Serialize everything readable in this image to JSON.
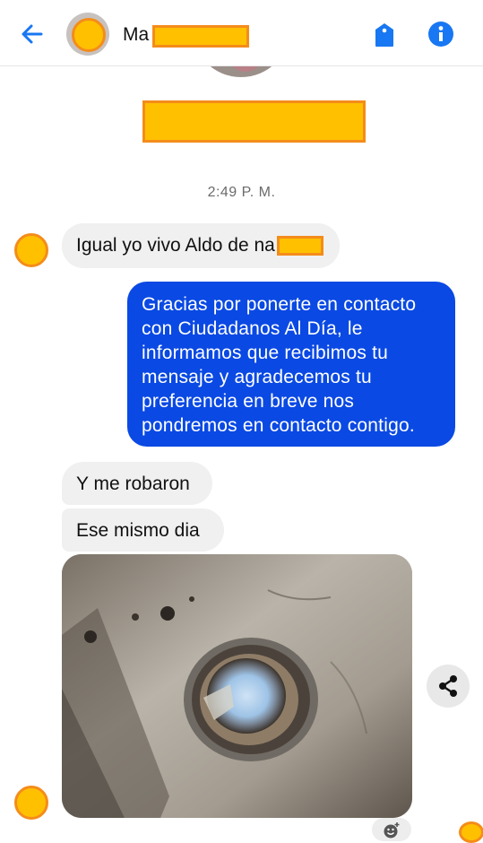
{
  "header": {
    "name_prefix": "Ma",
    "icons": {
      "back": "arrow-left-icon",
      "tag": "tag-icon",
      "info": "info-icon"
    }
  },
  "conversation": {
    "timestamp": "2:49 P. M.",
    "messages": [
      {
        "side": "received",
        "text": "Igual yo vivo Aldo de na"
      },
      {
        "side": "sent",
        "lines": [
          "Gracias por ponerte en contacto",
          "con Ciudadanos Al Día, le",
          "informamos que recibimos tu",
          "mensaje y agradecemos tu",
          "preferencia en breve nos",
          "pondremos en contacto contigo."
        ]
      },
      {
        "side": "received",
        "text": "Y me robaron"
      },
      {
        "side": "received",
        "text": "Ese mismo dia"
      },
      {
        "side": "received",
        "type": "photo"
      }
    ]
  },
  "actions": {
    "share_icon": "share-icon",
    "react_icon": "add-reaction-icon"
  },
  "colors": {
    "accent": "#0a49e3",
    "icon_blue": "#1877f2",
    "received_bubble": "#f0f0f0",
    "redaction_fill": "#ffc000",
    "redaction_border": "#f48c1b"
  }
}
